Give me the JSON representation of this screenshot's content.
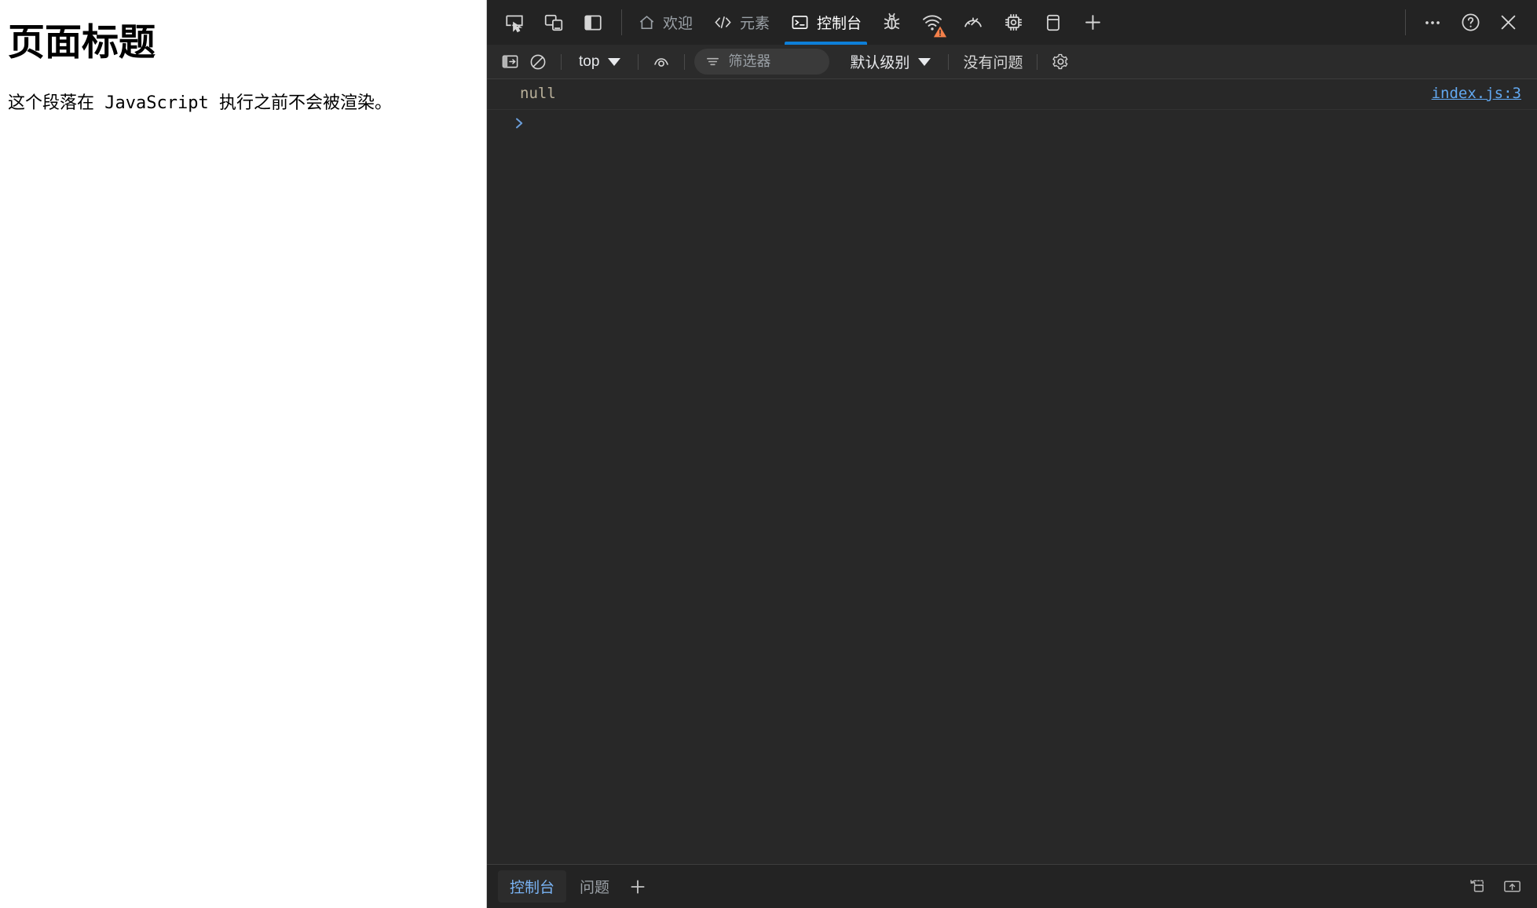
{
  "page": {
    "heading": "页面标题",
    "paragraph": "这个段落在 JavaScript 执行之前不会被渲染。"
  },
  "devtools": {
    "device_tools": [
      {
        "name": "inspect-element-icon",
        "title": "检查"
      },
      {
        "name": "device-toolbar-icon",
        "title": "设备模拟"
      },
      {
        "name": "dock-side-icon",
        "title": "停靠侧边"
      }
    ],
    "tabs": [
      {
        "label": "欢迎",
        "icon": "home-icon",
        "active": false
      },
      {
        "label": "元素",
        "icon": "code-brackets-icon",
        "active": false
      },
      {
        "label": "控制台",
        "icon": "console-terminal-icon",
        "active": true
      }
    ],
    "icon_tabs": [
      {
        "name": "sources-bug-icon",
        "badge": null
      },
      {
        "name": "network-wifi-icon",
        "badge": "warning"
      },
      {
        "name": "performance-gauge-icon",
        "badge": null
      },
      {
        "name": "memory-chip-icon",
        "badge": null
      },
      {
        "name": "application-storage-icon",
        "badge": null
      },
      {
        "name": "add-panel-plus-icon",
        "badge": null
      }
    ],
    "window_actions": [
      {
        "name": "more-options-icon",
        "label": "⋯"
      },
      {
        "name": "help-icon",
        "label": "?"
      },
      {
        "name": "close-devtools-icon",
        "label": "✕"
      }
    ],
    "active_tab_underline_color": "#0d7fd9",
    "warning_badge_color": "#f4804a"
  },
  "console_toolbar": {
    "sidebar_toggle": "console-sidebar-toggle-icon",
    "clear_console": "clear-console-icon",
    "context_value": "top",
    "eye_icon": "live-expression-icon",
    "filter": {
      "icon": "filter-icon",
      "placeholder": "筛选器",
      "value": ""
    },
    "level_value": "默认级别",
    "issues_label": "没有问题",
    "settings_icon": "settings-gear-icon"
  },
  "console": {
    "entries": [
      {
        "text": "null",
        "source": "index.js:3"
      }
    ],
    "prompt_caret": "❯",
    "prompt_value": "",
    "log_text_color": "#b9b09a",
    "link_color": "#62a8f0"
  },
  "drawer": {
    "tabs": [
      {
        "label": "控制台",
        "active": true
      },
      {
        "label": "问题",
        "active": false
      }
    ],
    "add_tab_icon": "add-tab-plus-icon",
    "right_icons": [
      {
        "name": "restore-drawer-icon"
      },
      {
        "name": "dock-to-bottom-icon"
      }
    ]
  }
}
